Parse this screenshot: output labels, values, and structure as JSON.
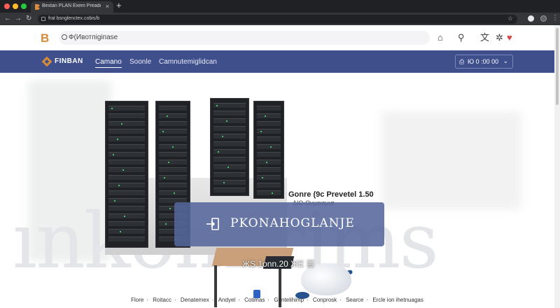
{
  "browser": {
    "tab_title": "Bextan PLAN Exem Preade",
    "url": "fral bsnglenctex.cobis/b",
    "new_tab_label": "+",
    "close_label": "×"
  },
  "site": {
    "search_text": "Ф(Ивотпіgіпаsе",
    "icons": [
      "home-icon",
      "user-icon",
      "language-icon",
      "favorite-icon",
      "heart-icon"
    ]
  },
  "navbar": {
    "brand": "FINBAN",
    "links": [
      "Camano",
      "Soonle",
      "Camnutemiglidcan"
    ],
    "select_value": "Ю 0 :00 00"
  },
  "hero": {
    "subtitle": "Gonre (9c Prevetel  1.50",
    "subtitle_2": "ΔΙΩ-Ωνμοιομισ",
    "overlay_title": "PKONAHOGLANJE",
    "caption": "ЖS 1оnn.20 ЖЕ  目",
    "watermark": "ınkomlrims"
  },
  "footer": {
    "links": [
      "Flore",
      "Roitacc",
      "Denatemex",
      "Andyel",
      "Cotimas",
      "Gontelihimp",
      "Conprosk",
      "Searce",
      "Ercle ion ihetnuagas"
    ],
    "separator": "·"
  },
  "colors": {
    "navbar": "#3f4f8c",
    "overlay": "#55679b",
    "brand_accent": "#d58b3a",
    "heart": "#d64545"
  }
}
